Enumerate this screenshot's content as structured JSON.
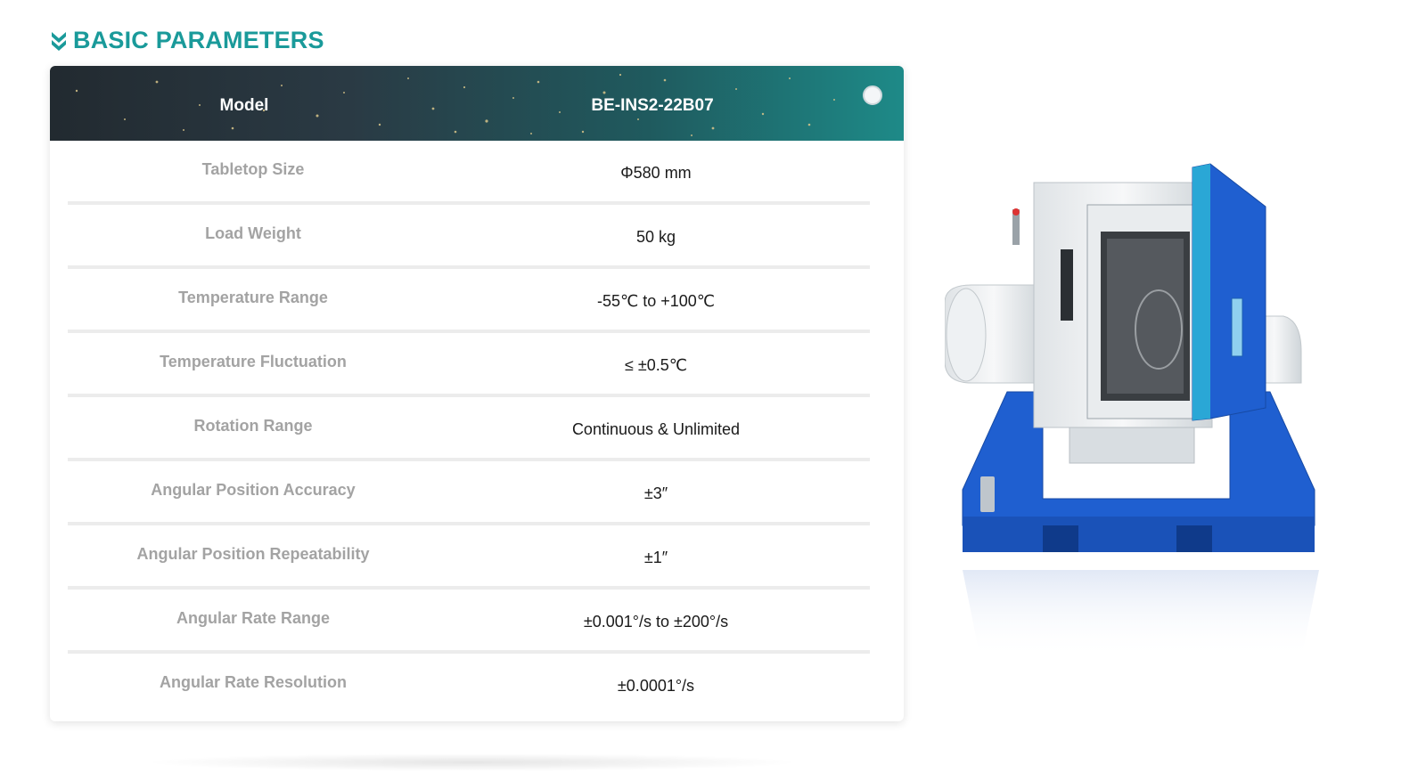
{
  "section": {
    "title": "BASIC PARAMETERS",
    "icon": "double-chevron-down-icon",
    "accent_color": "#1a9a9a"
  },
  "table": {
    "header": {
      "label": "Model",
      "value": "BE-INS2-22B07"
    },
    "rows": [
      {
        "label": "Tabletop Size",
        "value": "Φ580 mm"
      },
      {
        "label": "Load Weight",
        "value": "50 kg"
      },
      {
        "label": "Temperature Range",
        "value": "-55℃ to +100℃"
      },
      {
        "label": "Temperature Fluctuation",
        "value": "≤ ±0.5℃"
      },
      {
        "label": "Rotation Range",
        "value": "Continuous & Unlimited"
      },
      {
        "label": "Angular Position Accuracy",
        "value": "±3″"
      },
      {
        "label": "Angular Position Repeatability",
        "value": "±1″"
      },
      {
        "label": "Angular Rate Range",
        "value": "±0.001°/s to ±200°/s"
      },
      {
        "label": "Angular Rate Resolution",
        "value": "±0.0001°/s"
      }
    ]
  },
  "colors": {
    "machine_blue": "#1f5fd0",
    "door_cyan": "#2aa7d6",
    "chamber_gray": "#e9ecee"
  }
}
